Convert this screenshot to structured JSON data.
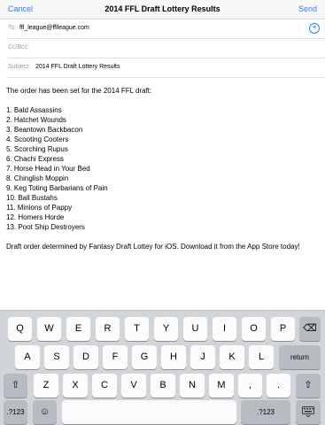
{
  "navbar": {
    "cancel": "Cancel",
    "title": "2014 FFL Draft Lottery Results",
    "send": "Send"
  },
  "fields": {
    "to_label": "To:",
    "to_value": "ffl_league@fflleague.com",
    "ccbcc_label": "Cc/Bcc:",
    "subject_label": "Subject:",
    "subject_value": "2014 FFL Draft Lottery Results"
  },
  "add_contact_glyph": "+",
  "message": {
    "intro": "The order has been set for the 2014 FFL draft:",
    "order": [
      "1. Bald Assassins",
      "2. Hatchet Wounds",
      "3. Beantown Backbacon",
      "4. Scooting Cooters",
      "5. Scorching Rupus",
      "6. Chachi Express",
      "7. Horse Head in Your Bed",
      "8. Chinglish Moppin",
      "9. Keg Toting Barbarians of Pain",
      "10. Ball Bustahs",
      "11. Minions of Pappy",
      "12. Homers Horde",
      "13. Poot Ship Destroyers"
    ],
    "footer": "Draft order determined by Fantasy Draft Lottey for iOS. Download it from the App Store today!"
  },
  "keyboard": {
    "row1": [
      "Q",
      "W",
      "E",
      "R",
      "T",
      "Y",
      "U",
      "I",
      "O",
      "P"
    ],
    "row2": [
      "A",
      "S",
      "D",
      "F",
      "G",
      "H",
      "J",
      "K",
      "L"
    ],
    "return": "return",
    "row3": [
      "Z",
      "X",
      "C",
      "V",
      "B",
      "N",
      "M",
      ",",
      "."
    ],
    "numbers": ".?123",
    "backspace_glyph": "⌫",
    "shift_glyph": "⇧",
    "emoji_glyph": "☺"
  }
}
